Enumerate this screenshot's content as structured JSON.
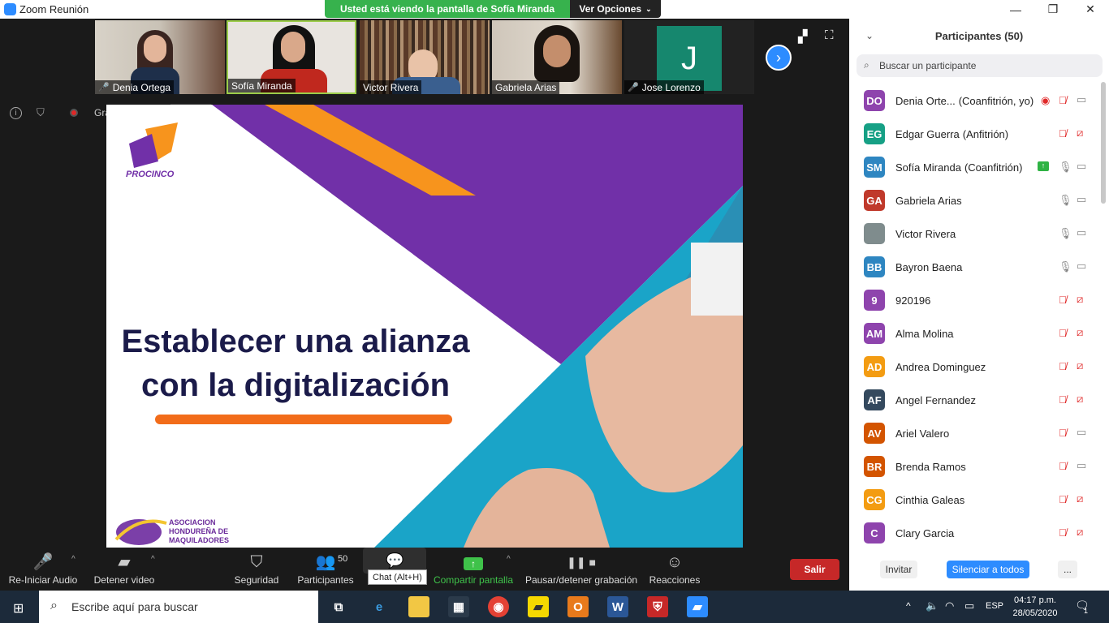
{
  "window": {
    "title": "Zoom Reunión",
    "share_banner": "Usted está viendo la pantalla de Sofía Miranda",
    "view_options": "Ver Opciones"
  },
  "thumbnails": [
    {
      "name": "Denia Ortega",
      "muted": true
    },
    {
      "name": "Sofía Miranda",
      "muted": false,
      "active": true
    },
    {
      "name": "Victor Rivera",
      "muted": false
    },
    {
      "name": "Gabriela Arias",
      "muted": false
    },
    {
      "name": "Jose Lorenzo",
      "muted": true,
      "initial": "J"
    }
  ],
  "recording": {
    "label": "Grabando..."
  },
  "slide": {
    "logo_text": "PROCINCO",
    "title_line1": "Establecer una alianza",
    "title_line2": "con la digitalización",
    "footer_org_line1": "ASOCIACION",
    "footer_org_line2": "HONDUREÑA DE",
    "footer_org_line3": "MAQUILADORES"
  },
  "panel": {
    "title": "Participantes (50)",
    "search_placeholder": "Buscar un participante",
    "participants": [
      {
        "initials": "DO",
        "name": "Denia Orte...",
        "role": "(Coanfitrión, yo)",
        "color": "#8e44ad",
        "recording": true,
        "mic": "muted",
        "video": "on"
      },
      {
        "initials": "EG",
        "name": "Edgar Guerra",
        "role": "(Anfitrión)",
        "color": "#16a085",
        "mic": "muted",
        "video": "off"
      },
      {
        "initials": "SM",
        "name": "Sofía Miranda",
        "role": "(Coanfitrión)",
        "color": "#2e86c1",
        "sharing": true,
        "mic": "on",
        "video": "on"
      },
      {
        "initials": "GA",
        "name": "Gabriela Arias",
        "role": "",
        "color": "#c0392b",
        "mic": "on",
        "video": "on"
      },
      {
        "initials": "",
        "name": "Victor Rivera",
        "role": "",
        "color": "#7f8c8d",
        "photo": true,
        "mic": "on",
        "video": "on"
      },
      {
        "initials": "BB",
        "name": "Bayron Baena",
        "role": "",
        "color": "#2e86c1",
        "mic": "on",
        "video": "on"
      },
      {
        "initials": "9",
        "name": "920196",
        "role": "",
        "color": "#8e44ad",
        "mic": "muted",
        "video": "off"
      },
      {
        "initials": "AM",
        "name": "Alma Molina",
        "role": "",
        "color": "#8e44ad",
        "mic": "muted",
        "video": "off"
      },
      {
        "initials": "AD",
        "name": "Andrea Dominguez",
        "role": "",
        "color": "#f39c12",
        "mic": "muted",
        "video": "off"
      },
      {
        "initials": "AF",
        "name": "Angel Fernandez",
        "role": "",
        "color": "#34495e",
        "mic": "muted",
        "video": "off"
      },
      {
        "initials": "AV",
        "name": "Ariel Valero",
        "role": "",
        "color": "#d35400",
        "mic": "muted",
        "video": "on"
      },
      {
        "initials": "BR",
        "name": "Brenda Ramos",
        "role": "",
        "color": "#d35400",
        "mic": "muted",
        "video": "on"
      },
      {
        "initials": "CG",
        "name": "Cinthia Galeas",
        "role": "",
        "color": "#f39c12",
        "mic": "muted",
        "video": "off"
      },
      {
        "initials": "C",
        "name": "Clary Garcia",
        "role": "",
        "color": "#8e44ad",
        "mic": "muted",
        "video": "off"
      }
    ],
    "invite": "Invitar",
    "mute_all": "Silenciar a todos",
    "more": "..."
  },
  "toolbar": {
    "audio": "Re-Iniciar Audio",
    "video": "Detener video",
    "security": "Seguridad",
    "participants": "Participantes",
    "participants_count": "50",
    "chat_tooltip": "Chat (Alt+H)",
    "share": "Compartir pantalla",
    "record": "Pausar/detener grabación",
    "reactions": "Reacciones",
    "leave": "Salir"
  },
  "taskbar": {
    "search_placeholder": "Escribe aquí para buscar",
    "lang": "ESP",
    "time": "04:17 p.m.",
    "date": "28/05/2020",
    "notifications": "1"
  }
}
